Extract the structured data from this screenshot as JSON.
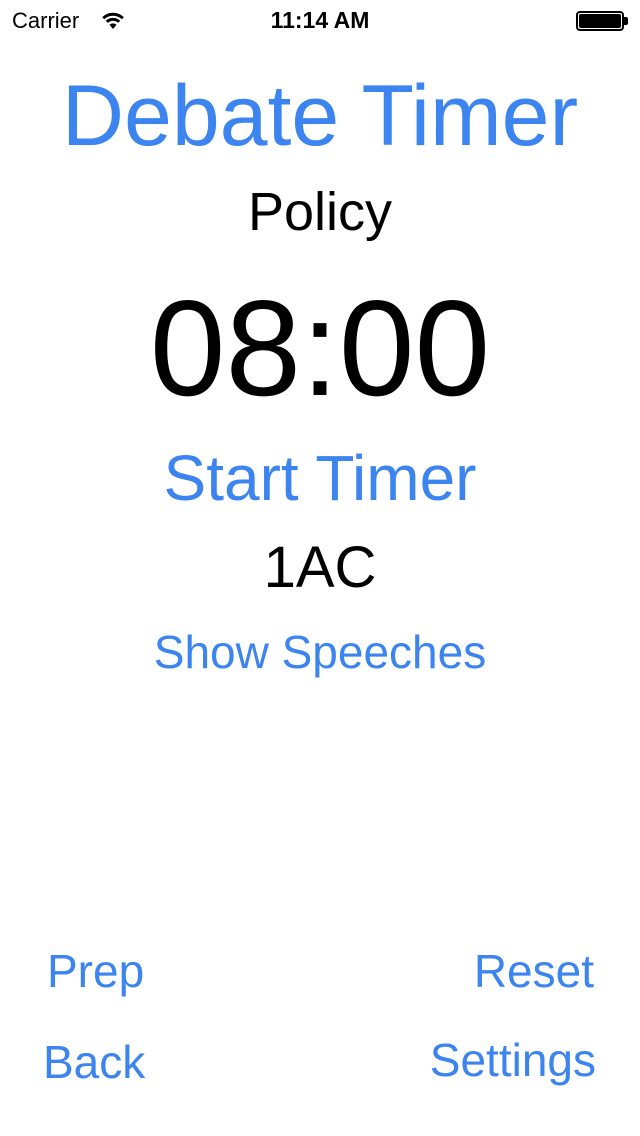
{
  "status_bar": {
    "carrier": "Carrier",
    "time": "11:14 AM",
    "battery_level": 1.0,
    "wifi_icon": "wifi-icon",
    "battery_icon": "battery-icon"
  },
  "app": {
    "title": "Debate Timer",
    "format": "Policy",
    "timer_value": "08:00",
    "start_label": "Start Timer",
    "current_speech": "1AC",
    "show_speeches_label": "Show Speeches"
  },
  "controls": {
    "prep_label": "Prep",
    "reset_label": "Reset",
    "back_label": "Back",
    "settings_label": "Settings"
  },
  "colors": {
    "accent": "#3c84f0",
    "text": "#000000",
    "background": "#ffffff"
  }
}
